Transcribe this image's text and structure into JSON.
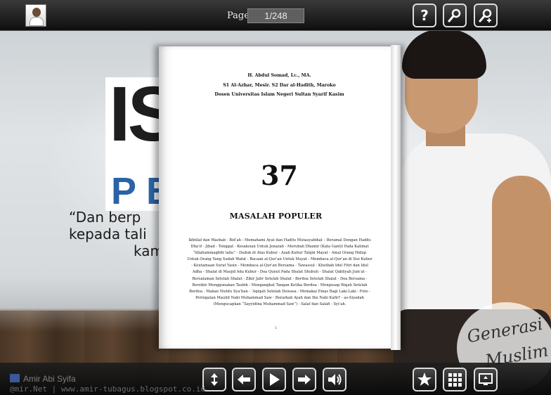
{
  "topbar": {
    "page_label": "Page:",
    "page_value": "1/248",
    "buttons": {
      "help": "help-icon",
      "zoom": "magnifier-icon",
      "zoom_in": "zoom-in-icon"
    }
  },
  "background": {
    "poster_big": "IS",
    "poster_sub": "PE",
    "quote_line_1": "“Dan berp",
    "quote_line_2": "kepada tali",
    "quote_line_3": "kam",
    "logo_line_1": "Generasi",
    "logo_line_2": "Muslim"
  },
  "page": {
    "author_line_1": "H. Abdul Somad, Lc., MA.",
    "author_line_2": "S1 Al-Azhar, Mesir. S2 Dar al-Hadith, Maroko",
    "author_line_3": "Dosen Universitas Islam Negeri Sultan Syarif Kasim",
    "chapter_number": "37",
    "chapter_title": "MASALAH POPULER",
    "toc": "Ikhtilaf dan Mazhab - Bid’ah - Memahami Ayat dan Hadits Mutasyabihat – Beramal Dengan Hadits Dha’if - Jihad - Tonggat - Kesaksian Untuk Jenazah - Merubah Dhamir (Kata Ganti) Pada Kalimat “Allahummaghfir lahu” - Duduk di Atas Kubur - Azab Kubur Talqin Mayat - Amal Orang Hidup Untuk Orang Yang Sudah Wafat - Bacaan al-Qur’an Untuk Mayat - Membaca al-Qur’an di Sisi Kubur - Keutamaan Surat Yasin - Membaca al-Qur’an Bersama - Tawassul - Khutbah Idul Fitri dan Idul Adha - Shalat di Masjid Ada Kubur - Doa Qunut Pada Shalat Shubuh - Shalat Qabliyah Jum’at - Bersalaman Setelah Shalat - Zikir Jahr Setelah Shalat - Berdoa Setelah Shalat - Doa Bersama - Berzikir Menggunakan Tasbih - Mengangkat Tangan Ketika Berdoa - Mengusap Wajah Setelah Berdoa - Makan Nishfu Sya’ban - ’Aqiqah Setelah Dewasa - Memakai Emas Bagi Laki-Laki - Foto - Peringatan Maulid Nabi Muhammad Saw - Berarkah Ayah dan Ibu Nabi Kafir? - as-Siyadah (Mengucapkan “Sayyidina Muhammad Saw”) - Salaf dan Salafi - Syi’ah.",
    "page_number": "1"
  },
  "bottombar": {
    "credit_name": "Amir Abi Syifa",
    "credit_url": "@mir.Net | www.amir-tubagus.blogspot.co.id",
    "buttons": {
      "fit": "fit-vertical-icon",
      "prev": "arrow-left-icon",
      "play": "play-icon",
      "next": "arrow-right-icon",
      "sound": "speaker-icon",
      "bookmark": "star-icon",
      "thumbnails": "grid-icon",
      "fullscreen": "fullscreen-icon"
    }
  }
}
